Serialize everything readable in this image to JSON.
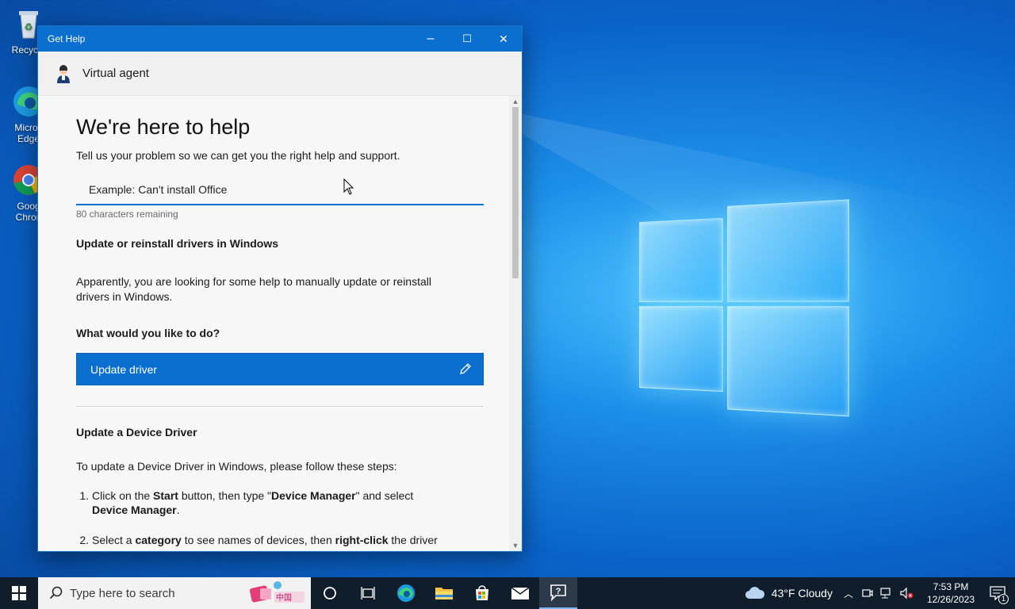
{
  "desktop": {
    "icons": [
      {
        "label": "Recycle",
        "icon": "recycle-bin-icon"
      },
      {
        "label": "Micros Edge",
        "icon": "edge-icon"
      },
      {
        "label": "Goog Chron",
        "icon": "chrome-icon"
      }
    ]
  },
  "window": {
    "title": "Get Help",
    "minimize": "–",
    "maximize": "☐",
    "close": "✕",
    "agent_name": "Virtual agent"
  },
  "help": {
    "heading": "We're here to help",
    "subtitle": "Tell us your problem so we can get you the right help and support.",
    "input_placeholder": "Example: Can't install Office",
    "char_count": "80 characters remaining",
    "topic_title": "Update or reinstall drivers in Windows",
    "topic_desc": "Apparently, you are looking for some help to manually update or reinstall drivers in Windows.",
    "question": "What would you like to do?",
    "action_label": "Update driver",
    "section_title": "Update a Device Driver",
    "section_intro": "To update a Device Driver in Windows, please follow these steps:",
    "steps": [
      {
        "a": "Click on the ",
        "b": "Start",
        "c": " button, then type \"",
        "d": "Device Manager",
        "e": "\" and select ",
        "f": "Device Manager",
        "g": "."
      },
      {
        "a": "Select a ",
        "b": "category",
        "c": " to see names of devices, then ",
        "d": "right-click",
        "e": " the driver"
      }
    ]
  },
  "taskbar": {
    "search_placeholder": "Type here to search",
    "weather": "43°F  Cloudy",
    "time": "7:53 PM",
    "date": "12/26/2023",
    "notification_count": "1"
  },
  "colors": {
    "accent": "#0b6fd0",
    "taskbar": "#101d2b"
  }
}
